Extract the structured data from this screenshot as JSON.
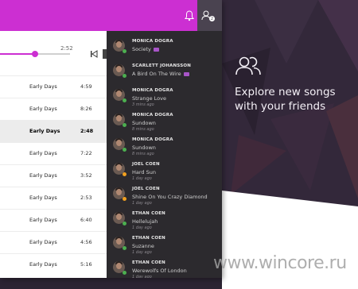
{
  "player": {
    "elapsed": "2:52",
    "progress": 0.33
  },
  "tracks": [
    {
      "album": "Early Days",
      "duration": "4:59",
      "active": false
    },
    {
      "album": "Early Days",
      "duration": "8:26",
      "active": false
    },
    {
      "album": "Early Days",
      "duration": "2:48",
      "active": true
    },
    {
      "album": "Early Days",
      "duration": "7:22",
      "active": false
    },
    {
      "album": "Early Days",
      "duration": "3:52",
      "active": false
    },
    {
      "album": "Early Days",
      "duration": "2:53",
      "active": false
    },
    {
      "album": "Early Days",
      "duration": "6:40",
      "active": false
    },
    {
      "album": "Early Days",
      "duration": "4:56",
      "active": false
    },
    {
      "album": "Early Days",
      "duration": "5:16",
      "active": false
    }
  ],
  "friends": [
    {
      "name": "MONICA DOGRA",
      "song": "Society",
      "time": "",
      "badge": true,
      "status_color": "#4caf50"
    },
    {
      "name": "SCARLETT JOHANSSON",
      "song": "A Bird On The Wire",
      "time": "",
      "badge": true,
      "status_color": "#4caf50"
    },
    {
      "name": "MONICA DOGRA",
      "song": "Strange Love",
      "time": "3 mins ago",
      "badge": false,
      "status_color": "#4caf50"
    },
    {
      "name": "MONICA DOGRA",
      "song": "Sundown",
      "time": "8 mins ago",
      "badge": false,
      "status_color": "#4caf50"
    },
    {
      "name": "MONICA DOGRA",
      "song": "Sundown",
      "time": "8 mins ago",
      "badge": false,
      "status_color": "#4caf50"
    },
    {
      "name": "JOEL COEN",
      "song": "Hard Sun",
      "time": "1 day ago",
      "badge": false,
      "status_color": "#f0a020"
    },
    {
      "name": "JOEL COEN",
      "song": "Shine On You Crazy Diamond",
      "time": "1 day ago",
      "badge": false,
      "status_color": "#f0a020"
    },
    {
      "name": "ETHAN COEN",
      "song": "Hellelujah",
      "time": "1 day ago",
      "badge": false,
      "status_color": "#4caf50"
    },
    {
      "name": "ETHAN COEN",
      "song": "Suzanne",
      "time": "1 day ago",
      "badge": false,
      "status_color": "#4caf50"
    },
    {
      "name": "ETHAN COEN",
      "song": "Werewolfs Of London",
      "time": "1 day ago",
      "badge": false,
      "status_color": "#4caf50"
    }
  ],
  "notifications": {
    "friends_count": "2"
  },
  "promo": {
    "line1": "Explore new songs",
    "line2": "with your friends"
  },
  "watermark": "www.wincore.ru",
  "colors": {
    "accent": "#cc2fd2",
    "panel": "#2c2a2e",
    "online": "#4caf50",
    "away": "#f0a020"
  },
  "icons": {
    "bell": "bell-icon",
    "friends": "friends-icon",
    "previous": "previous-track-icon"
  }
}
